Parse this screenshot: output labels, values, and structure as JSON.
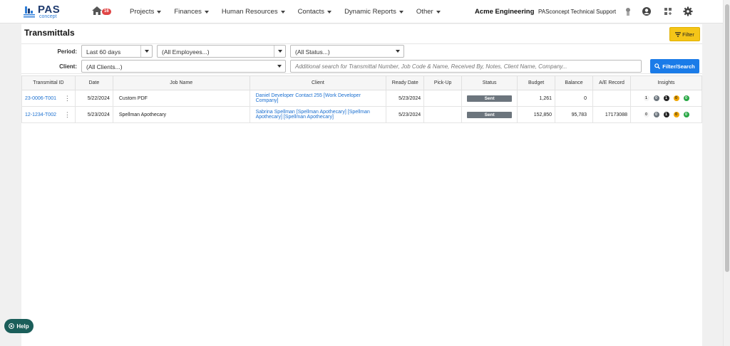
{
  "nav": {
    "logo_text": "PAS",
    "logo_sub": "concept",
    "home_badge": "16",
    "menu": [
      "Projects",
      "Finances",
      "Human Resources",
      "Contacts",
      "Dynamic Reports",
      "Other"
    ],
    "company": "Acme Engineering",
    "support": "PASconcept Technical Support"
  },
  "page": {
    "title": "Transmittals",
    "filter_button": "Filter"
  },
  "filters": {
    "period_label": "Period:",
    "period_value": "Last 60 days",
    "employees_value": "(All Employees...)",
    "status_value": "(All Status...)",
    "client_label": "Client:",
    "client_value": "(All Clients...)",
    "search_placeholder": "Additional search for Transmittal Number, Job Code & Name, Received By, Notes, Client Name, Company...",
    "search_button": "Filter/Search"
  },
  "table": {
    "headers": [
      "Transmittal ID",
      "Date",
      "Job Name",
      "Client",
      "Ready Date",
      "Pick-Up",
      "Status",
      "Budget",
      "Balance",
      "A/E Record",
      "Insights"
    ],
    "rows": [
      {
        "id": "23-0006-T001",
        "date": "5/22/2024",
        "job_name": "Custom PDF",
        "client": "Daniel Developer Contact 255 [Work Developer Company]",
        "ready_date": "5/23/2024",
        "pickup": "",
        "status": "Sent",
        "budget": "1,261",
        "balance": "0",
        "ae_record": "",
        "insights": [
          "1",
          "0",
          "1",
          "0",
          "0"
        ]
      },
      {
        "id": "12-1234-T002",
        "date": "5/23/2024",
        "job_name": "Spellman Apothecary",
        "client": "Sabrina Spellman [Spellman Apothecary] [Spellman Apothecary] [Spellman Apothecary]",
        "ready_date": "5/23/2024",
        "pickup": "",
        "status": "Sent",
        "budget": "152,850",
        "balance": "95,783",
        "ae_record": "17173088",
        "insights": [
          "0",
          "0",
          "1",
          "0",
          "0"
        ]
      }
    ]
  },
  "help": "Help"
}
